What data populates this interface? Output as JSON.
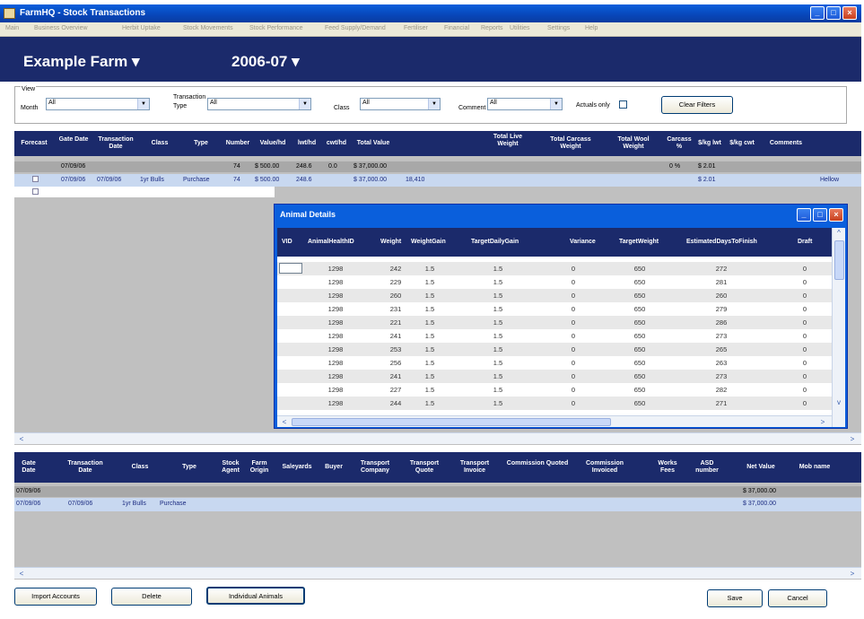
{
  "window": {
    "title": "FarmHQ - Stock Transactions",
    "min": "_",
    "max": "□",
    "close": "×"
  },
  "menu": [
    "Main",
    "Business Overview",
    "Herbit Uptake",
    "Stock Movements",
    "Stock Performance",
    "Feed Supply/Demand",
    "Fertiliser",
    "Financial",
    "Reports",
    "Utilities",
    "Settings",
    "Help"
  ],
  "header": {
    "farm": "Example Farm",
    "season": "2006-07"
  },
  "filters": {
    "group_label": "View",
    "month_label": "Month",
    "month_value": "All",
    "type_label_1": "Transaction",
    "type_label_2": "Type",
    "type_value": "All",
    "class_label": "Class",
    "class_value": "All",
    "comment_label": "Comment",
    "comment_value": "All",
    "actuals_label": "Actuals only",
    "clear_button": "Clear Filters"
  },
  "top_grid": {
    "headers": [
      "Forecast",
      "Gate Date",
      "Transaction Date",
      "Class",
      "Type",
      "Number",
      "Value/hd",
      "lwt/hd",
      "cwt/hd",
      "Total Value",
      "Total Live Weight",
      "Total Carcass Weight",
      "Total Wool Weight",
      "Carcass %",
      "$/kg lwt",
      "$/kg cwt",
      "Comments"
    ],
    "rows": [
      {
        "gate_date": "07/09/06",
        "trans_date": "",
        "class": "",
        "type": "",
        "number": "74",
        "value_hd": "$ 500.00",
        "lwt_hd": "248.6",
        "cwt_hd": "0.0",
        "total_value": "$ 37,000.00",
        "live_wt": "",
        "carcass": "0 %",
        "kg_lwt": "$ 2.01",
        "comments": ""
      },
      {
        "gate_date": "07/09/06",
        "trans_date": "07/09/06",
        "class": "1yr Bulls",
        "type": "Purchase",
        "number": "74",
        "value_hd": "$ 500.00",
        "lwt_hd": "248.6",
        "cwt_hd": "",
        "total_value": "$ 37,000.00",
        "live_wt": "18,410",
        "carcass": "",
        "kg_lwt": "$ 2.01",
        "comments": "Hellow"
      }
    ]
  },
  "animal_dialog": {
    "title": "Animal Details",
    "headers": [
      "VID",
      "AnimalHealthID",
      "Weight",
      "WeightGain",
      "TargetDailyGain",
      "Variance",
      "TargetWeight",
      "EstimatedDaysToFinish",
      "Draft"
    ],
    "rows": [
      [
        "1298",
        "242",
        "1.5",
        "1.5",
        "0",
        "650",
        "272",
        "0"
      ],
      [
        "1298",
        "229",
        "1.5",
        "1.5",
        "0",
        "650",
        "281",
        "0"
      ],
      [
        "1298",
        "260",
        "1.5",
        "1.5",
        "0",
        "650",
        "260",
        "0"
      ],
      [
        "1298",
        "231",
        "1.5",
        "1.5",
        "0",
        "650",
        "279",
        "0"
      ],
      [
        "1298",
        "221",
        "1.5",
        "1.5",
        "0",
        "650",
        "286",
        "0"
      ],
      [
        "1298",
        "241",
        "1.5",
        "1.5",
        "0",
        "650",
        "273",
        "0"
      ],
      [
        "1298",
        "253",
        "1.5",
        "1.5",
        "0",
        "650",
        "265",
        "0"
      ],
      [
        "1298",
        "256",
        "1.5",
        "1.5",
        "0",
        "650",
        "263",
        "0"
      ],
      [
        "1298",
        "241",
        "1.5",
        "1.5",
        "0",
        "650",
        "273",
        "0"
      ],
      [
        "1298",
        "227",
        "1.5",
        "1.5",
        "0",
        "650",
        "282",
        "0"
      ],
      [
        "1298",
        "244",
        "1.5",
        "1.5",
        "0",
        "650",
        "271",
        "0"
      ]
    ]
  },
  "bottom_grid": {
    "headers": [
      "Gate Date",
      "Transaction Date",
      "Class",
      "Type",
      "Stock Agent",
      "Farm Origin",
      "Saleyards",
      "Buyer",
      "Transport Company",
      "Transport Quote",
      "Transport Invoice",
      "Commission Quoted",
      "Commission Invoiced",
      "Works Fees",
      "ASD number",
      "Net Value",
      "Mob name"
    ],
    "rows": [
      {
        "gate_date": "07/09/06",
        "trans_date": "",
        "class": "",
        "type": "",
        "net_value": "$ 37,000.00"
      },
      {
        "gate_date": "07/09/06",
        "trans_date": "07/09/06",
        "class": "1yr Bulls",
        "type": "Purchase",
        "net_value": "$ 37,000.00"
      }
    ]
  },
  "buttons": {
    "import": "Import Accounts",
    "delete": "Delete",
    "individual": "Individual Animals",
    "save": "Save",
    "cancel": "Cancel"
  },
  "scroll": {
    "left": "<",
    "right": ">",
    "up": "^",
    "down": "v"
  },
  "colors": {
    "title_blue": "#0a5fdc",
    "header_navy": "#1b2a6b",
    "selected_row": "#c8d8f0",
    "grid_gray": "#c0c0c0"
  }
}
